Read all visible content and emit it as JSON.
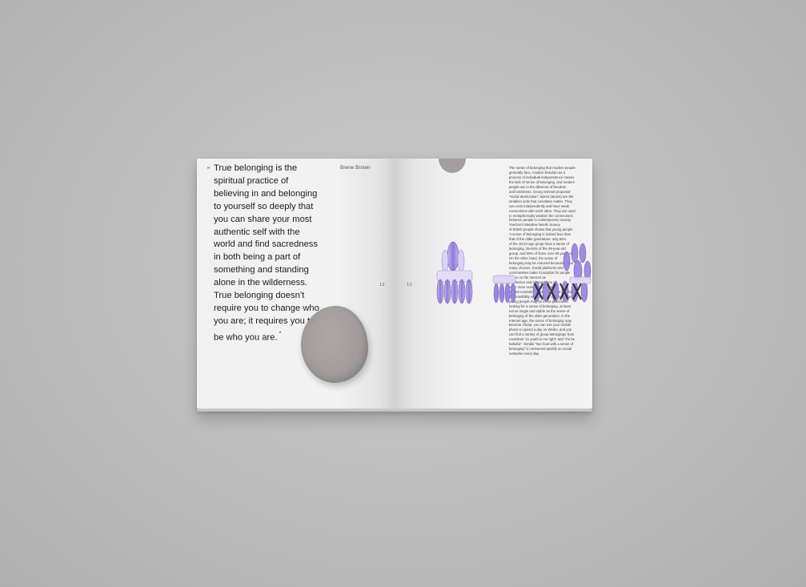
{
  "spread": {
    "left_page": {
      "quote_open_mark": "”",
      "quote": "True belonging is the\nspiritual practice of\nbelieving in and belonging\nto yourself so deeply that\nyou can share your most\nauthentic self with the\nworld and find sacredness\nin both being a part of\nsomething and standing\nalone in the wilderness.\nTrue belonging doesn’t\nrequire you to change who\nyou are; it requires you to\nbe who you are.",
      "quote_close_mark": "”",
      "author": "Brene Brown",
      "page_number": "12"
    },
    "right_page": {
      "page_number": "13",
      "body_text": "The sense of belonging that modern people\ngenerally face, modern freedom as a\nprocess of individual independence means\nthe lack of sense of belonging, and modern\npeople are in the dilemma of freedom\nand loneliness. Georg Simmel proposed\n\"social atomization\" atoms (atoms) are the\nsmallest units that constitute matter. They\ncan exist independently and have weak\nconnections with each other. They are used\nto metaphorically weaken the connections\nbetween people in contemporary society.\n        YouGov's Meadow Needs Survey\nof British people shows that young people\n's sense of belonging is indeed less than\nthat of the older generation: only 56%\nof the 18-24 age group have a sense of\nbelonging, 25-54% of the 49-year-old\ngroup, and 60% of those over 65 years old.\n        On the other hand, the sense of\nbelonging may be reduced because of too\nmany choices. Social platforms and\ncommunities make it possible for people\nto live on the Internet as\nproduction and consumption\neven more resistant to become\n\"digital nomads\". These freedoms also bring\nthe possibility of emancies. Contemporary\nyoung people may be in the process of\nlooking for a sense of belonging, at least\nnot as single and stable as the sense of\nbelonging of the older generation. In the\nInternet age, the sense of belonging may\nbecome cheap: you can use your mobile\nphone to spend a day on Weibo, and you\ncan find a variety of group belongings from\ncountless \"xx youth is me right\" and \"I'm he\nhahaha\". Similar \"two food with a sense of\nbelonging\" is consumed quickly on social\nnetworks every day."
    }
  },
  "colors": {
    "background": "#bdbdbe",
    "paper": "#f2f2f2",
    "blob": "#9c9494",
    "ornament_purple": "#9b86e0",
    "ornament_dark": "#2a2a2a"
  },
  "icons": [
    "purple-gem-ornament",
    "purple-crown-ornament",
    "purple-lattice-ornament"
  ]
}
